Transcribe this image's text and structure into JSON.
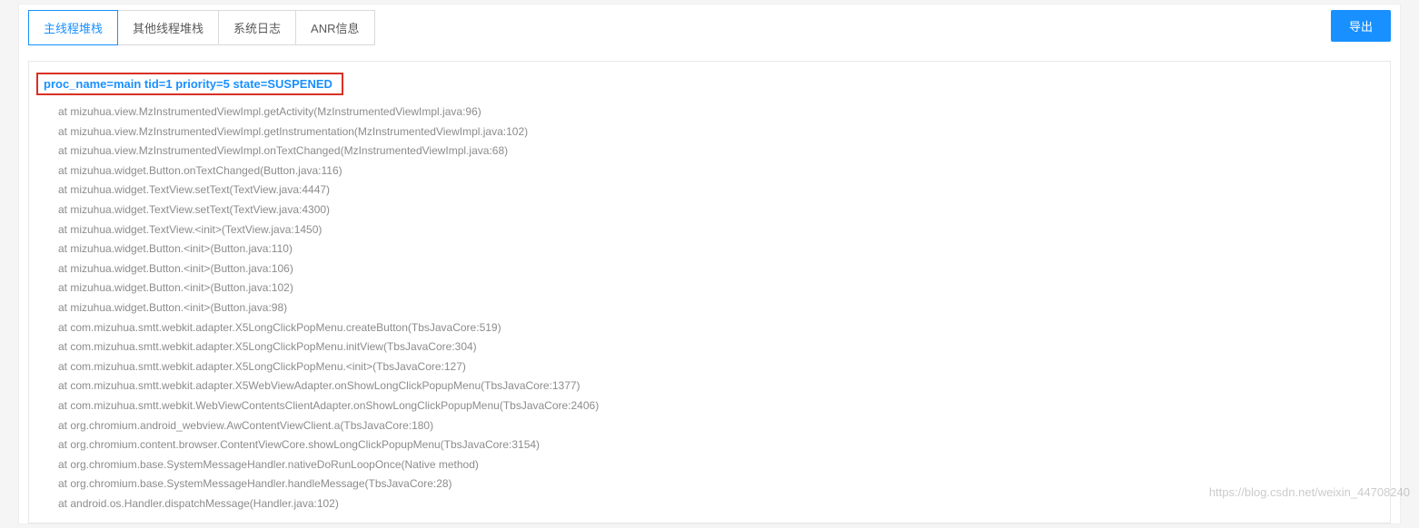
{
  "tabs": [
    {
      "label": "主线程堆栈",
      "active": true
    },
    {
      "label": "其他线程堆栈",
      "active": false
    },
    {
      "label": "系统日志",
      "active": false
    },
    {
      "label": "ANR信息",
      "active": false
    }
  ],
  "export_button": "导出",
  "thread_header": "proc_name=main tid=1 priority=5 state=SUSPENED",
  "stack_frames": [
    "at mizuhua.view.MzInstrumentedViewImpl.getActivity(MzInstrumentedViewImpl.java:96)",
    "at mizuhua.view.MzInstrumentedViewImpl.getInstrumentation(MzInstrumentedViewImpl.java:102)",
    "at mizuhua.view.MzInstrumentedViewImpl.onTextChanged(MzInstrumentedViewImpl.java:68)",
    "at mizuhua.widget.Button.onTextChanged(Button.java:116)",
    "at mizuhua.widget.TextView.setText(TextView.java:4447)",
    "at mizuhua.widget.TextView.setText(TextView.java:4300)",
    "at mizuhua.widget.TextView.<init>(TextView.java:1450)",
    "at mizuhua.widget.Button.<init>(Button.java:110)",
    "at mizuhua.widget.Button.<init>(Button.java:106)",
    "at mizuhua.widget.Button.<init>(Button.java:102)",
    "at mizuhua.widget.Button.<init>(Button.java:98)",
    "at com.mizuhua.smtt.webkit.adapter.X5LongClickPopMenu.createButton(TbsJavaCore:519)",
    "at com.mizuhua.smtt.webkit.adapter.X5LongClickPopMenu.initView(TbsJavaCore:304)",
    "at com.mizuhua.smtt.webkit.adapter.X5LongClickPopMenu.<init>(TbsJavaCore:127)",
    "at com.mizuhua.smtt.webkit.adapter.X5WebViewAdapter.onShowLongClickPopupMenu(TbsJavaCore:1377)",
    "at com.mizuhua.smtt.webkit.WebViewContentsClientAdapter.onShowLongClickPopupMenu(TbsJavaCore:2406)",
    "at org.chromium.android_webview.AwContentViewClient.a(TbsJavaCore:180)",
    "at org.chromium.content.browser.ContentViewCore.showLongClickPopupMenu(TbsJavaCore:3154)",
    "at org.chromium.base.SystemMessageHandler.nativeDoRunLoopOnce(Native method)",
    "at org.chromium.base.SystemMessageHandler.handleMessage(TbsJavaCore:28)",
    "at android.os.Handler.dispatchMessage(Handler.java:102)"
  ],
  "watermark": "https://blog.csdn.net/weixin_44708240"
}
